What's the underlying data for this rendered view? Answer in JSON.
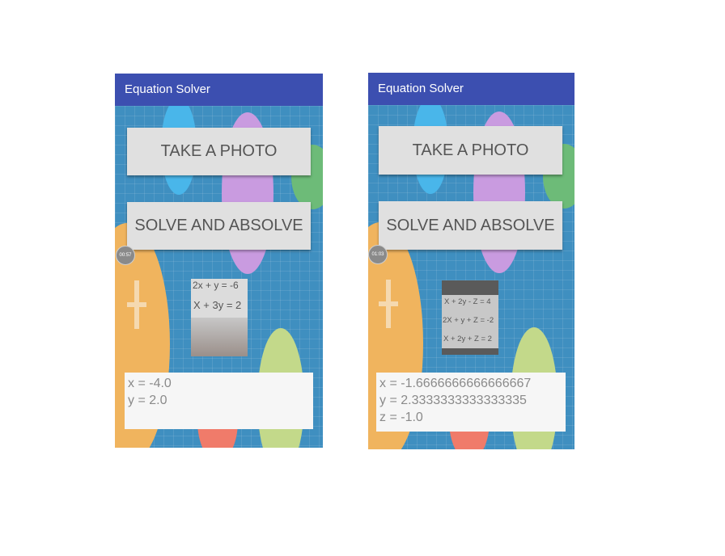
{
  "screens": [
    {
      "title": "Equation Solver",
      "take_photo": "TAKE A PHOTO",
      "solve": "SOLVE AND ABSOLVE",
      "timer": "00:57",
      "photo_lines": [
        "2x + y = -6",
        "X + 3y = 2"
      ],
      "results": [
        "x =  -4.0",
        "y = 2.0"
      ]
    },
    {
      "title": "Equation Solver",
      "take_photo": "TAKE A PHOTO",
      "solve": "SOLVE AND ABSOLVE",
      "timer": "01:03",
      "photo_lines": [
        "X + 2y - Z = 4",
        "2X + y + Z = -2",
        "X + 2y + Z = 2"
      ],
      "results": [
        "x = -1.6666666666666667",
        "y = 2.3333333333333335",
        "z = -1.0"
      ]
    }
  ],
  "colors": {
    "appbar": "#3c4fb0",
    "background": "#3f8fc0",
    "button": "#e0e0e0",
    "result_panel": "#f6f6f6"
  }
}
